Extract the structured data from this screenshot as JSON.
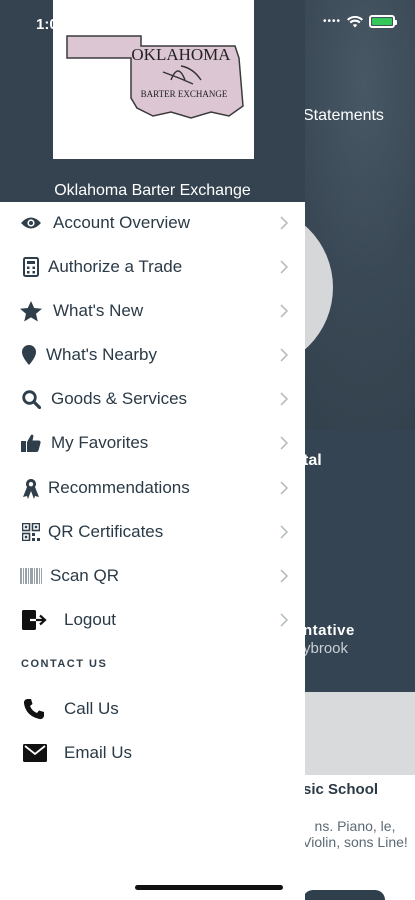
{
  "status_bar": {
    "time": "1:0"
  },
  "background": {
    "tab_statements": "Statements",
    "partial_heading": "tal",
    "partial_role": "ntative",
    "partial_name": "ybrook",
    "card_title": "sic School",
    "card_description": "ns. Piano, le, Violin, sons Line!"
  },
  "drawer": {
    "logo": {
      "line1": "OKLAHOMA",
      "line2": "BARTER EXCHANGE"
    },
    "title": "Oklahoma Barter Exchange",
    "menu": [
      {
        "label": "Account Overview",
        "icon": "eye-icon"
      },
      {
        "label": "Authorize a Trade",
        "icon": "calculator-icon"
      },
      {
        "label": "What's New",
        "icon": "star-icon"
      },
      {
        "label": "What's Nearby",
        "icon": "map-pin-icon"
      },
      {
        "label": "Goods & Services",
        "icon": "search-icon"
      },
      {
        "label": "My Favorites",
        "icon": "thumbs-up-icon"
      },
      {
        "label": "Recommendations",
        "icon": "ribbon-icon"
      },
      {
        "label": "QR Certificates",
        "icon": "qr-code-icon"
      },
      {
        "label": "Scan QR",
        "icon": "barcode-icon"
      },
      {
        "label": "Logout",
        "icon": "logout-icon"
      }
    ],
    "contact_section_label": "CONTACT US",
    "contact": [
      {
        "label": "Call Us",
        "icon": "phone-icon"
      },
      {
        "label": "Email Us",
        "icon": "envelope-icon"
      }
    ]
  },
  "colors": {
    "header_bg": "#34434f",
    "icon": "#2e3e4a",
    "text": "#2a3a46",
    "battery": "#34c759"
  }
}
